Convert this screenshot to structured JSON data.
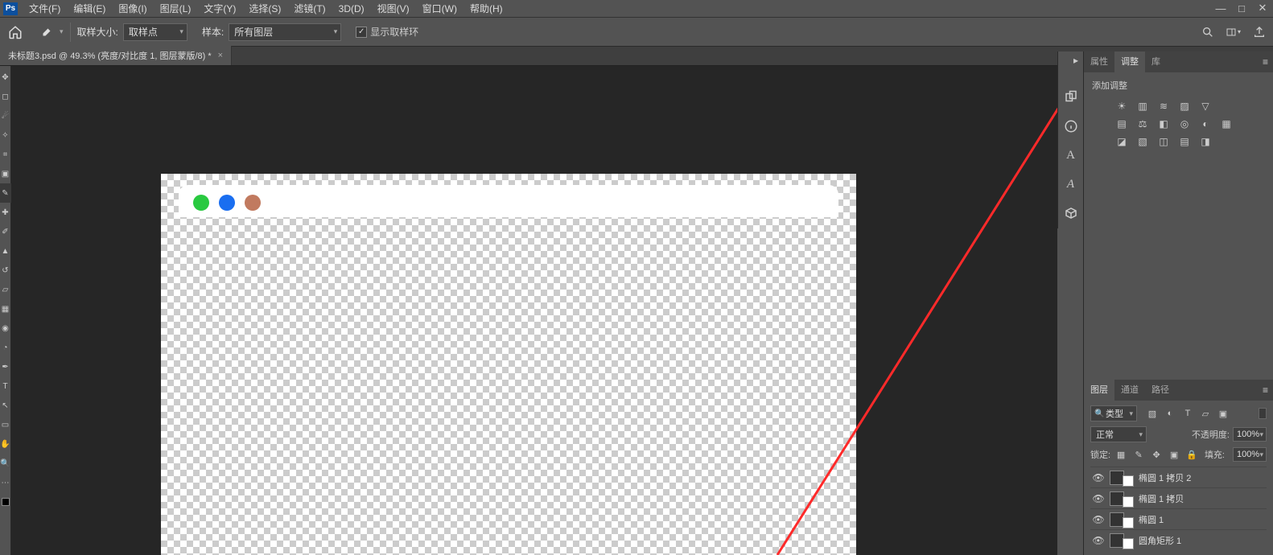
{
  "app": {
    "logo": "Ps"
  },
  "menu": [
    "文件(F)",
    "编辑(E)",
    "图像(I)",
    "图层(L)",
    "文字(Y)",
    "选择(S)",
    "滤镜(T)",
    "3D(D)",
    "视图(V)",
    "窗口(W)",
    "帮助(H)"
  ],
  "options": {
    "sample_size_label": "取样大小:",
    "sample_size_value": "取样点",
    "sample_label": "样本:",
    "sample_value": "所有图层",
    "show_ring_label": "显示取样环",
    "show_ring_checked": "✓"
  },
  "doc_tab": {
    "title": "未标题3.psd @ 49.3% (亮度/对比度 1, 图层蒙版/8) *",
    "close": "×"
  },
  "adjustments_panel": {
    "tabs": {
      "properties": "属性",
      "adjustments": "调整",
      "libraries": "库"
    },
    "title": "添加调整"
  },
  "layers_panel": {
    "tabs": {
      "layers": "图层",
      "channels": "通道",
      "paths": "路径"
    },
    "filter_label": "类型",
    "blend_mode": "正常",
    "opacity_label": "不透明度:",
    "opacity_value": "100%",
    "lock_label": "锁定:",
    "fill_label": "填充:",
    "fill_value": "100%",
    "layers": [
      {
        "name": "椭圆 1 拷贝 2"
      },
      {
        "name": "椭圆 1 拷贝"
      },
      {
        "name": "椭圆 1"
      },
      {
        "name": "圆角矩形 1"
      }
    ]
  }
}
